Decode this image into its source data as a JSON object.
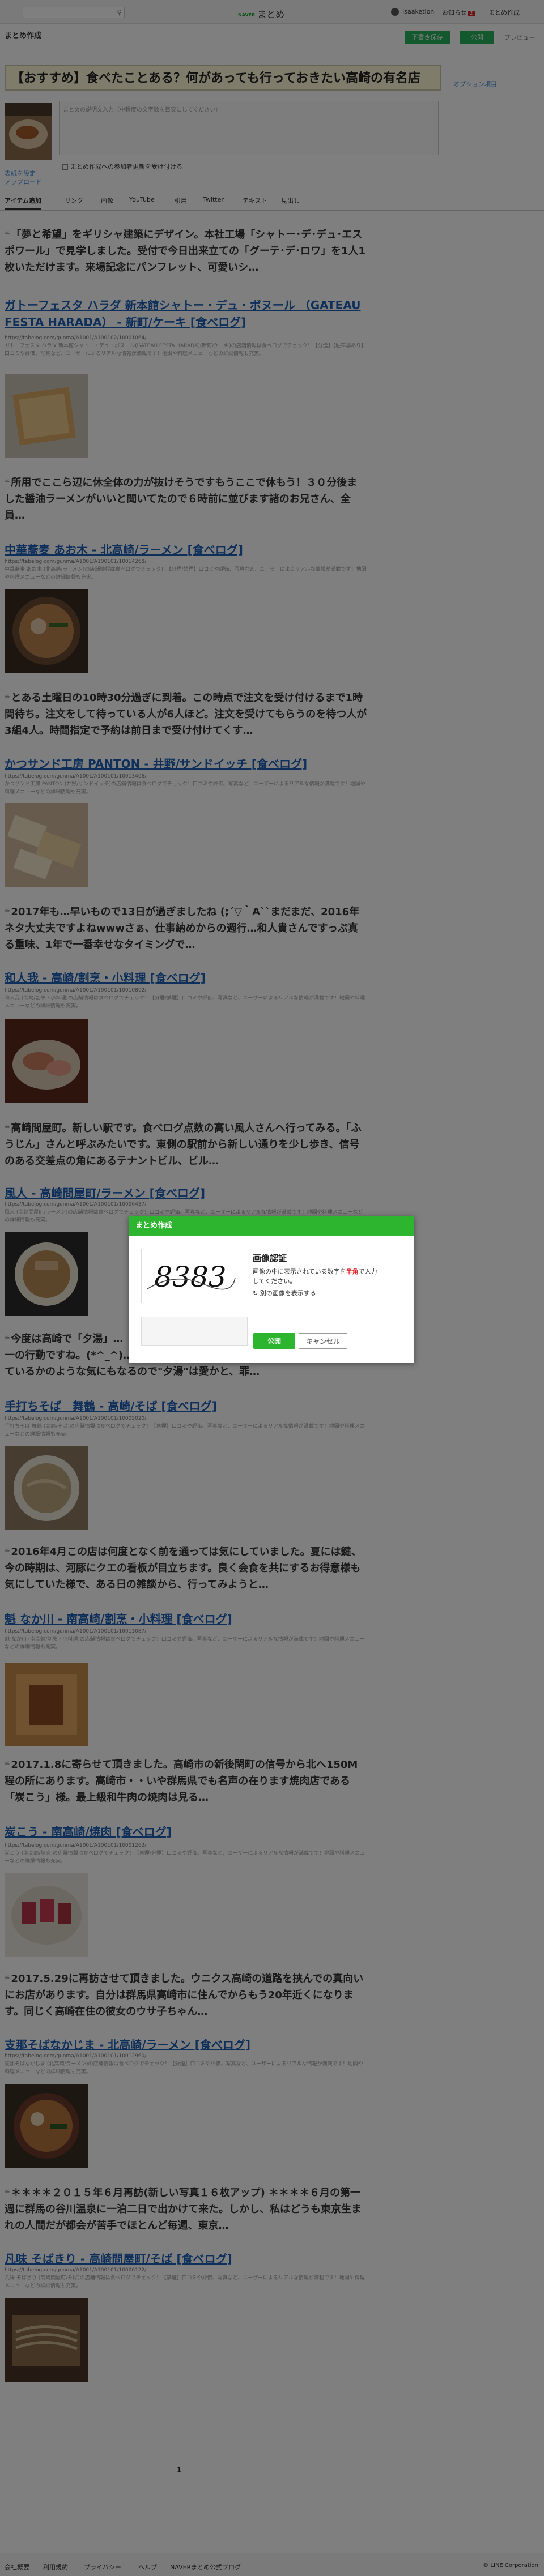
{
  "topbar": {
    "logo_service": "NAVER",
    "logo_text": "まとめ",
    "username": "Isaaketion",
    "messages_label": "お知らせ",
    "messages_count": "2",
    "my_matome": "まとめ作成"
  },
  "editor": {
    "page_label": "まとめ作成",
    "save_draft": "下書き保存",
    "publish": "公開",
    "preview": "プレビュー",
    "title": "【おすすめ】食べたことある？何があっても行っておきたい高崎の有名店",
    "option_label": "オプション項目",
    "description_placeholder": "まとめの説明文入力（中程度の文字数を目安にしてください）",
    "cover_link": "表紙を設定\nアップロード",
    "checkbox_label": "まとめ作成への参加者更新を受け付ける"
  },
  "tabs": [
    "アイテム追加",
    "リンク",
    "画像",
    "YouTube",
    "引用",
    "Twitter",
    "テキスト",
    "見出し"
  ],
  "items": [
    {
      "quote": "「夢と希望」をギリシャ建築にデザイン。本社工場「シャトー･デ･デュ･エスポワール」で見学しました。受付で今日出来立ての「グーテ･デ･ロワ」を1人1枚いただけます。来場記念にパンフレット、可愛いシ…",
      "title": "ガトーフェスタ ハラダ 新本館シャトー・デュ・ボヌール （GATEAU FESTA HARADA） - 新町/ケーキ [食べログ]",
      "url": "https://tabelog.com/gunma/A1001/A100102/10001064/",
      "desc": "ガトーフェスタ ハラダ 新本館シャトー・デュ・ボヌール(GATEAU FESTA HARADA)(新町/ケーキ)の店舗情報は食べログでチェック！【分煙】【駐車場あり】口コミや評価、写真など、ユーザーによるリアルな情報が満載です！地図や料理メニューなどの詳細情報も充実。"
    },
    {
      "quote": "所用でここら辺に休全体の力が抜けそうですもうここで休もう！３０分後ました醤油ラーメンがいいと聞いてたので６時前に並びます諸のお兄さん、全員…",
      "title": "中華蕎麦 あお木 - 北高崎/ラーメン [食べログ]",
      "url": "https://tabelog.com/gunma/A1001/A100101/10014268/",
      "desc": "中華蕎麦 あお木 (北高崎/ラーメン)の店舗情報は食べログでチェック！【分煙/禁煙】口コミや評価、写真など、ユーザーによるリアルな情報が満載です！地図や料理メニューなどの詳細情報も充実。"
    },
    {
      "quote": "とある土曜日の10時30分過ぎに到着。この時点で注文を受け付けるまで1時間待ち。注文をして待っている人が6人ほど。注文を受けてもらうのを待つ人が3組4人。時間指定で予約は前日まで受け付けてくす…",
      "title": "かつサンド工房 PANTON - 井野/サンドイッチ [食べログ]",
      "url": "https://tabelog.com/gunma/A1001/A100101/10013406/",
      "desc": "かつサンド工房 PANTON (井野/サンドイッチ)の店舗情報は食べログでチェック！口コミや評価、写真など、ユーザーによるリアルな情報が満載です！地図や料理メニューなどの詳細情報も充実。"
    },
    {
      "quote": "2017年も…早いもので13日が過ぎましたね (;´▽｀A``まだまだ、2016年ネタ大丈夫ですよねwwwさぁ、仕事納めからの週行…和人貴さんですっぷ真る重味、1年で一番幸せなタイミングで…",
      "title": "和人我 - 高崎/割烹・小料理 [食べログ]",
      "url": "https://tabelog.com/gunma/A1001/A100101/10010802/",
      "desc": "和人我 (高崎/割烹・小料理)の店舗情報は食べログでチェック！【分煙/禁煙】口コミや評価、写真など、ユーザーによるリアルな情報が満載です！地図や料理メニューなどの詳細情報も充実。"
    },
    {
      "quote": "高崎問屋町。新しい駅です。食べログ点数の高い風人さんへ行ってみる。「ふうじん」さんと呼ぶみたいです。東側の駅前から新しい通りを少し歩き、信号のある交差点の角にあるテナントビル、ビル…",
      "title": "風人 - 高崎問屋町/ラーメン [食べログ]",
      "url": "https://tabelog.com/gunma/A1001/A100101/10006437/",
      "desc": "風人 (高崎問屋町/ラーメン)の店舗情報は食べログでチェック！口コミや評価、写真など、ユーザーによるリアルな情報が満載です！地図や料理メニューなどの詳細情報も充実。"
    },
    {
      "quote": "今度は高崎で「夕湯」…\n一の行動ですね。(*^_^)…\nているかのような気にもなるので\"夕湯\"は愛かと、罪…",
      "title": "手打ちそば　舞鶴 - 高崎/そば [食べログ]",
      "url": "https://tabelog.com/gunma/A1001/A100101/10005020/",
      "desc": "手打ちそば 舞鶴 (高崎/そば)の店舗情報は食べログでチェック！【禁煙】口コミや評価、写真など、ユーザーによるリアルな情報が満載です！地図や料理メニューなどの詳細情報も充実。"
    },
    {
      "quote": "2016年4月この店は何度となく前を通っては気にしていました。夏には鍵、今の時期は、河豚にクエの看板が目立ちます。良く会食を共にするお得意様も気にしていた様で、ある日の雑談から、行ってみようと…",
      "title": "魁 なか川 - 南高崎/割烹・小料理 [食べログ]",
      "url": "https://tabelog.com/gunma/A1001/A100101/10013087/",
      "desc": "魁 なか川 (南高崎/割烹・小料理)の店舗情報は食べログでチェック！口コミや評価、写真など、ユーザーによるリアルな情報が満載です！地図や料理メニューなどの詳細情報も充実。"
    },
    {
      "quote": "2017.1.8に寄らせて頂きました。高崎市の新後閑町の信号から北へ150M程の所にあります。高崎市・・いや群馬県でも名声の在ります焼肉店である「炭こう」様。最上級和牛肉の焼肉は見る…",
      "title": "炭こう - 南高崎/焼肉 [食べログ]",
      "url": "https://tabelog.com/gunma/A1001/A100101/10001262/",
      "desc": "炭こう (南高崎/焼肉)の店舗情報は食べログでチェック！【禁煙/分煙】口コミや評価、写真など、ユーザーによるリアルな情報が満載です！地図や料理メニューなどの詳細情報も充実。"
    },
    {
      "quote": "2017.5.29に再訪させて頂きました。ウニクス高崎の道路を挟んでの真向いにお店があります。自分は群馬県高崎市に住んでからもう20年近くになります。同じく高崎在住の彼女のウサ子ちゃん…",
      "title": "支那そばなかじま - 北高崎/ラーメン [食べログ]",
      "url": "https://tabelog.com/gunma/A1001/A100101/10012960/",
      "desc": "支那そばなかじま (北高崎/ラーメン)の店舗情報は食べログでチェック！【分煙】口コミや評価、写真など、ユーザーによるリアルな情報が満載です！地図や料理メニューなどの詳細情報も充実。"
    },
    {
      "quote": "＊＊＊＊２０１５年６月再訪(新しい写真１６枚アップ) ＊＊＊＊６月の第一週に群馬の谷川温泉に一泊二日で出かけて来た。しかし、私はどうも東京生まれの人間だが都会が苦手でほとんど毎週、東京…",
      "title": "凡味 そばきり - 高崎問屋町/そば [食べログ]",
      "url": "https://tabelog.com/gunma/A1001/A100101/10006122/",
      "desc": "凡味 そばきり (高崎問屋町/そば)の店舗情報は食べログでチェック！【禁煙】口コミや評価、写真など、ユーザーによるリアルな情報が満載です！地図や料理メニューなどの詳細情報も充実。"
    }
  ],
  "pager": {
    "current": "1"
  },
  "footer": {
    "links": [
      "会社概要",
      "利用規約",
      "プライバシー",
      "ヘルプ",
      "NAVERまとめ公式ブログ"
    ],
    "copyright": "© LINE Corporation"
  },
  "modal": {
    "header": "まとめ作成",
    "captcha_text": "8383",
    "title": "画像認証",
    "instruction_prefix": "画像の中に表示されている数字を",
    "instruction_em": "半角",
    "instruction_suffix": "で入力してください。",
    "refresh": "別の画像を表示する",
    "ok": "公開",
    "cancel": "キャンセル"
  }
}
